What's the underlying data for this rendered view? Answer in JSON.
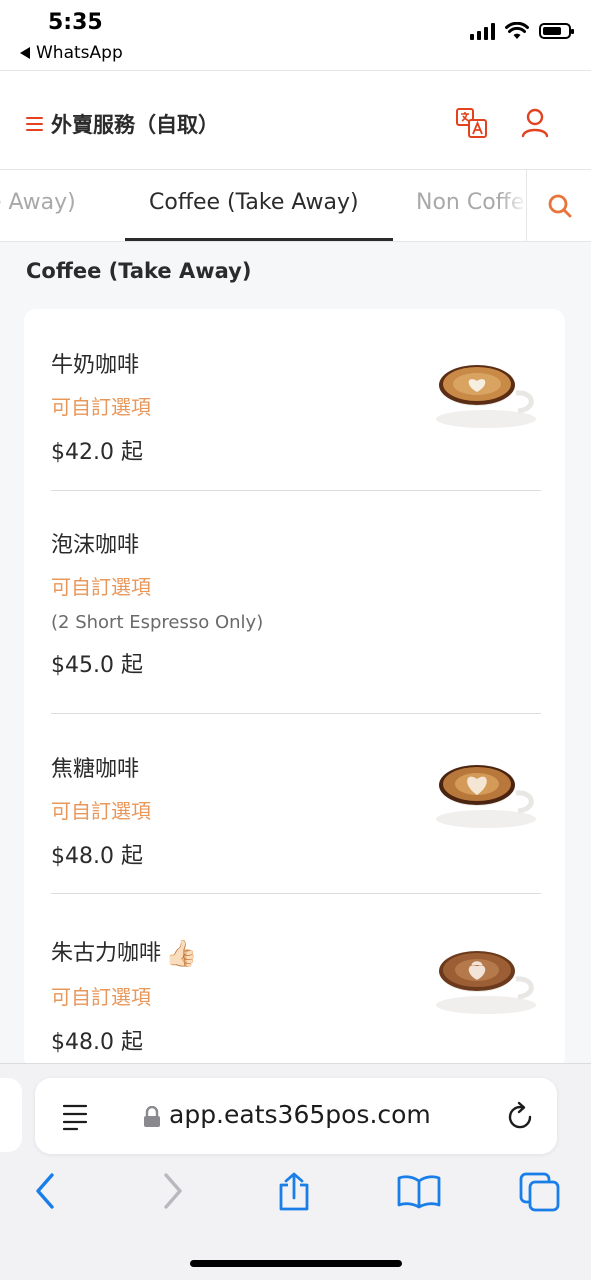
{
  "status_bar": {
    "time": "5:35",
    "back_app": "WhatsApp"
  },
  "header": {
    "title": "外賣服務（自取）"
  },
  "tabs": [
    {
      "label": "ke Away)"
    },
    {
      "label": "Coffee (Take Away)"
    },
    {
      "label": "Non Coffe"
    }
  ],
  "section": {
    "title": "Coffee (Take Away)"
  },
  "items": [
    {
      "name": "牛奶咖啡",
      "option": "可自訂選項",
      "price": "$42.0 起"
    },
    {
      "name": "泡沫咖啡",
      "option": "可自訂選項",
      "note": "(2 Short Espresso Only)",
      "price": "$45.0 起"
    },
    {
      "name": "焦糖咖啡",
      "option": "可自訂選項",
      "price": "$48.0 起"
    },
    {
      "name": "朱古力咖啡",
      "emoji": "👍🏻",
      "option": "可自訂選項",
      "price": "$48.0 起"
    }
  ],
  "safari": {
    "url": "app.eats365pos.com"
  },
  "colors": {
    "accent": "#e2421f",
    "option": "#e8975b",
    "ios_blue": "#1a7ee8"
  }
}
